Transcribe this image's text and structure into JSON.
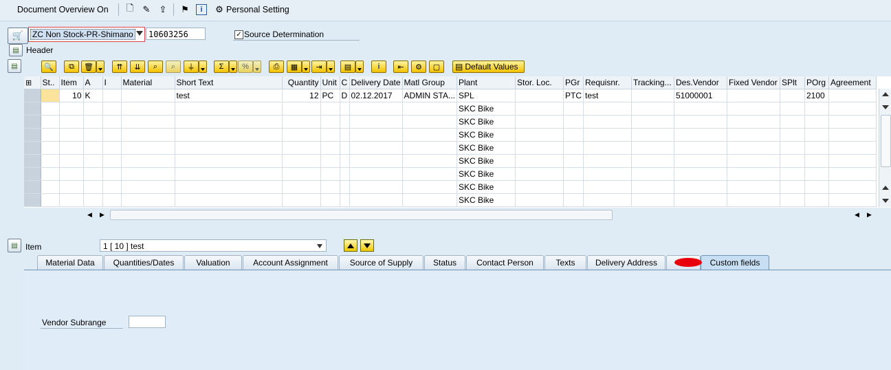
{
  "toolbar": {
    "document_overview": "Document Overview On",
    "personal_setting": "Personal Setting"
  },
  "doc": {
    "type": "ZC Non Stock-PR-Shimano",
    "number": "10603256",
    "source_determination": "Source Determination",
    "source_determination_checked": true,
    "header": "Header"
  },
  "table_toolbar": {
    "default_values": "Default Values"
  },
  "grid": {
    "columns": [
      "St..",
      "Item",
      "A",
      "I",
      "Material",
      "Short Text",
      "Quantity",
      "Unit",
      "C",
      "Delivery Date",
      "Matl Group",
      "Plant",
      "Stor. Loc.",
      "PGr",
      "Requisnr.",
      "Tracking...",
      "Des.Vendor",
      "Fixed Vendor",
      "SPlt",
      "POrg",
      "Agreement"
    ],
    "rows": [
      [
        "",
        "10",
        "K",
        "",
        "",
        "test",
        "12",
        "PC",
        "D",
        "02.12.2017",
        "ADMIN STA...",
        "SPL",
        "",
        "PTC",
        "test",
        "",
        "51000001",
        "",
        "",
        "2100",
        ""
      ],
      [
        "",
        "",
        "",
        "",
        "",
        "",
        "",
        "",
        "",
        "",
        "",
        "SKC Bike",
        "",
        "",
        "",
        "",
        "",
        "",
        "",
        "",
        ""
      ],
      [
        "",
        "",
        "",
        "",
        "",
        "",
        "",
        "",
        "",
        "",
        "",
        "SKC Bike",
        "",
        "",
        "",
        "",
        "",
        "",
        "",
        "",
        ""
      ],
      [
        "",
        "",
        "",
        "",
        "",
        "",
        "",
        "",
        "",
        "",
        "",
        "SKC Bike",
        "",
        "",
        "",
        "",
        "",
        "",
        "",
        "",
        ""
      ],
      [
        "",
        "",
        "",
        "",
        "",
        "",
        "",
        "",
        "",
        "",
        "",
        "SKC Bike",
        "",
        "",
        "",
        "",
        "",
        "",
        "",
        "",
        ""
      ],
      [
        "",
        "",
        "",
        "",
        "",
        "",
        "",
        "",
        "",
        "",
        "",
        "SKC Bike",
        "",
        "",
        "",
        "",
        "",
        "",
        "",
        "",
        ""
      ],
      [
        "",
        "",
        "",
        "",
        "",
        "",
        "",
        "",
        "",
        "",
        "",
        "SKC Bike",
        "",
        "",
        "",
        "",
        "",
        "",
        "",
        "",
        ""
      ],
      [
        "",
        "",
        "",
        "",
        "",
        "",
        "",
        "",
        "",
        "",
        "",
        "SKC Bike",
        "",
        "",
        "",
        "",
        "",
        "",
        "",
        "",
        ""
      ],
      [
        "",
        "",
        "",
        "",
        "",
        "",
        "",
        "",
        "",
        "",
        "",
        "SKC Bike",
        "",
        "",
        "",
        "",
        "",
        "",
        "",
        "",
        ""
      ]
    ]
  },
  "item": {
    "label": "Item",
    "selected": "1 [ 10 ] test"
  },
  "tabs": [
    "Material Data",
    "Quantities/Dates",
    "Valuation",
    "Account Assignment",
    "Source of Supply",
    "Status",
    "Contact Person",
    "Texts",
    "Delivery Address",
    "Custom fields"
  ],
  "active_tab": "Custom fields",
  "custom_fields": {
    "vendor_subrange_label": "Vendor Subrange",
    "vendor_subrange_value": ""
  },
  "colors": {
    "background": "#dfebf5",
    "highlight_yellow": "#fbe39b",
    "button_yellow": "#f2c200",
    "redaction": "#e8000a"
  }
}
